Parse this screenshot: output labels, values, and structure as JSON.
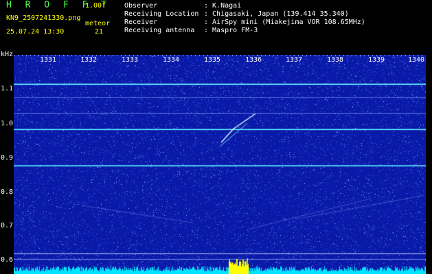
{
  "header": {
    "app_title": "H R O F F T",
    "version": "1.00f",
    "filename": "KN9_2507241330.png",
    "datetime": "25.07.24 13:30",
    "meteor_label": "meteor",
    "meteor_count": "21"
  },
  "info": [
    {
      "label": "Observer",
      "value": ": K.Nagai"
    },
    {
      "label": "Receiving Location",
      "value": ": Chigasaki, Japan (139.414 35.340)"
    },
    {
      "label": "Receiver",
      "value": ": AirSpy mini (Miakejima VOR 108.65MHz)"
    },
    {
      "label": "Receiving antenna",
      "value": ": Maspro FM-3"
    }
  ],
  "spectrogram": {
    "y_unit": "kHz",
    "y_ticks": [
      "1.1",
      "1.0",
      "0.9",
      "0.8",
      "0.7",
      "0.6"
    ],
    "x_ticks": [
      "1331",
      "1332",
      "1333",
      "1334",
      "1335",
      "1336",
      "1337",
      "1338",
      "1339",
      "1340"
    ],
    "colors": {
      "background": "#0a1aa8",
      "noise": "#4a7cff",
      "carrier": "#5fe8ff",
      "bottom_band": "#00e5ff",
      "burst": "#ffff00",
      "header_green": "#4cff4c",
      "header_yellow": "#ffff00"
    }
  }
}
